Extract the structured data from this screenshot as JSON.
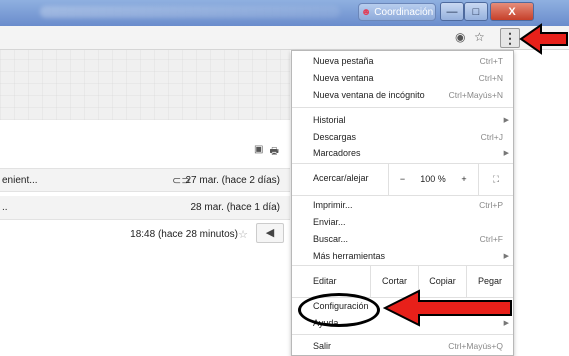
{
  "window": {
    "profile_name": "Coordinación",
    "profile_icon": "user-icon",
    "minimize": "—",
    "maximize": "□",
    "close": "X"
  },
  "toolbar": {
    "eye_icon": "◉",
    "star_icon": "☆",
    "menu_icon": "⋮"
  },
  "header_icons": {
    "print_icon": "🖶",
    "expand_icon": "▣"
  },
  "emails": [
    {
      "snippet": "enient...",
      "date": "27 mar. (hace 2 días)",
      "attachment": true
    },
    {
      "snippet": "..",
      "date": "28 mar. (hace 1 día)"
    },
    {
      "snippet": "",
      "date": "18:48 (hace 28 minutos)"
    }
  ],
  "menu": {
    "new_tab": "Nueva pestaña",
    "new_tab_sc": "Ctrl+T",
    "new_window": "Nueva ventana",
    "new_window_sc": "Ctrl+N",
    "incognito": "Nueva ventana de incógnito",
    "incognito_sc": "Ctrl+Mayús+N",
    "history": "Historial",
    "downloads": "Descargas",
    "downloads_sc": "Ctrl+J",
    "bookmarks": "Marcadores",
    "zoom_label": "Acercar/alejar",
    "zoom_minus": "−",
    "zoom_value": "100 %",
    "zoom_plus": "+",
    "print": "Imprimir...",
    "print_sc": "Ctrl+P",
    "send": "Enviar...",
    "find": "Buscar...",
    "find_sc": "Ctrl+F",
    "more_tools": "Más herramientas",
    "edit": "Editar",
    "cut": "Cortar",
    "copy": "Copiar",
    "paste": "Pegar",
    "settings": "Configuración",
    "help": "Ayuda",
    "exit": "Salir",
    "exit_sc": "Ctrl+Mayús+Q",
    "submenu_arrow": "▶"
  },
  "annotation_colors": {
    "arrow": "#e8201a",
    "outline": "#000000"
  }
}
